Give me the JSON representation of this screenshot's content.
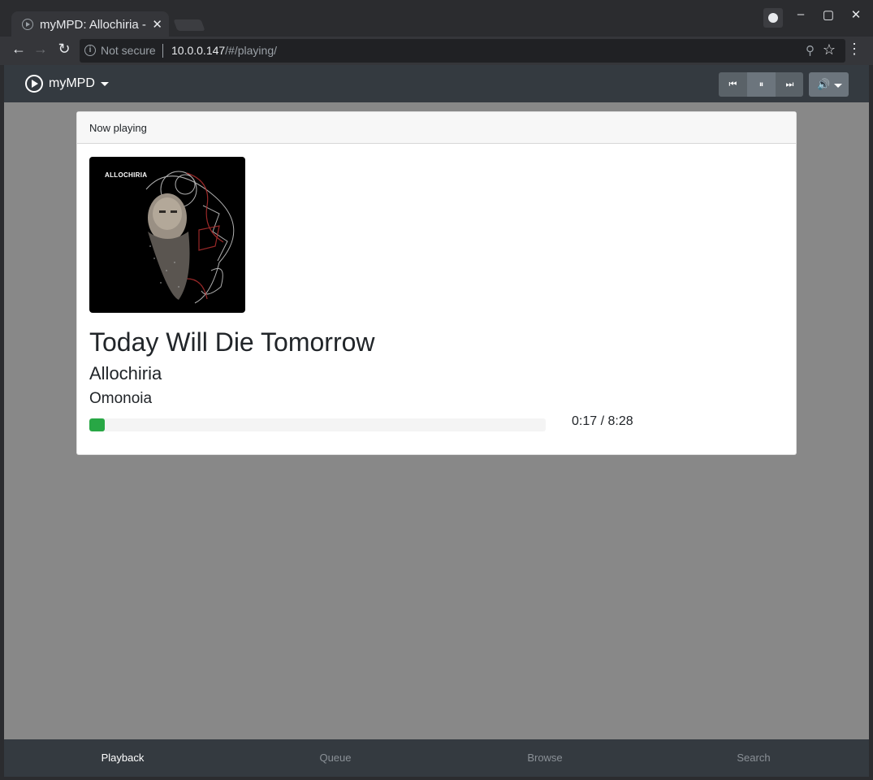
{
  "browser": {
    "tab_title": "myMPD: Allochiria - Today Will Die Tomorrow",
    "tab_close": "✕",
    "window_buttons": [
      "–",
      "▢",
      "✕"
    ],
    "nav": {
      "back": "←",
      "forward": "→",
      "reload": "↻"
    },
    "security_label": "Not secure",
    "url_host": "10.0.0.147",
    "url_path": "/#/playing/",
    "icons": {
      "zoom": "⚲",
      "star": "☆",
      "menu": "⋮"
    }
  },
  "app": {
    "brand": "myMPD",
    "controls": {
      "prev": "⏮",
      "pause": "⏸",
      "next": "⏭",
      "volume": "🔊"
    },
    "card_header": "Now playing",
    "cover_text": "ALLOCHIRIA",
    "song": {
      "title": "Today Will Die Tomorrow",
      "artist": "Allochiria",
      "album": "Omonoia"
    },
    "progress": {
      "elapsed": "0:17",
      "separator": "/",
      "duration": "8:28",
      "fraction": 0.033,
      "color": "#28a745"
    },
    "footer": [
      {
        "label": "Playback",
        "active": true
      },
      {
        "label": "Queue",
        "active": false
      },
      {
        "label": "Browse",
        "active": false
      },
      {
        "label": "Search",
        "active": false
      }
    ]
  }
}
